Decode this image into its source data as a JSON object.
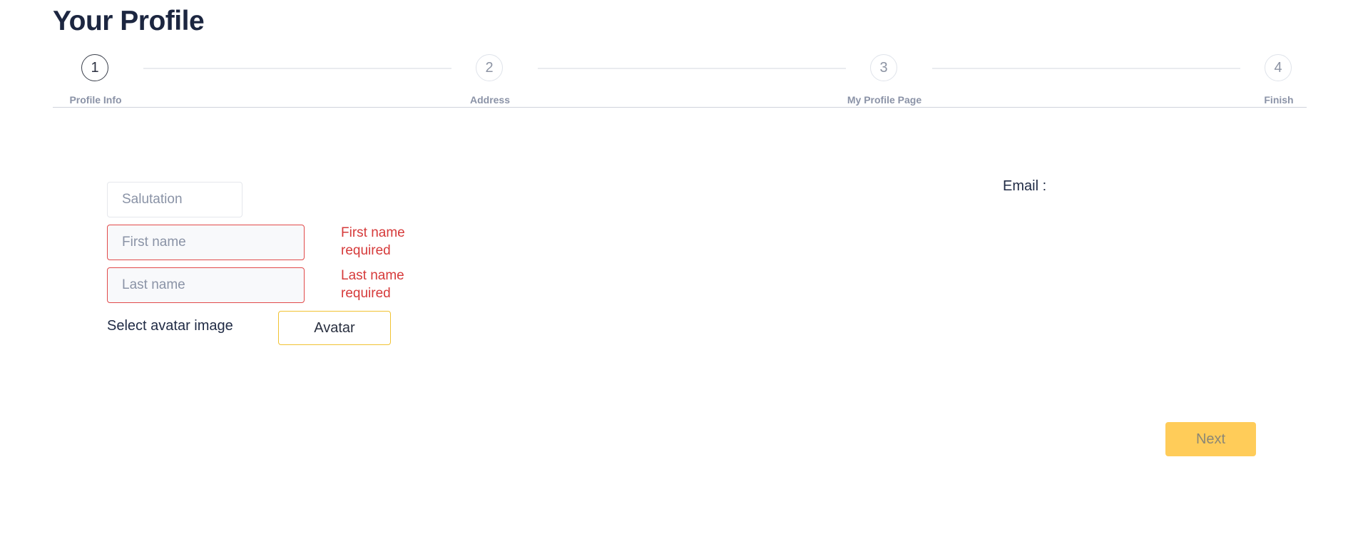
{
  "page": {
    "title": "Your Profile"
  },
  "stepper": {
    "steps": [
      {
        "number": "1",
        "label": "Profile Info",
        "active": true
      },
      {
        "number": "2",
        "label": "Address",
        "active": false
      },
      {
        "number": "3",
        "label": "My Profile Page",
        "active": false
      },
      {
        "number": "4",
        "label": "Finish",
        "active": false
      }
    ]
  },
  "form": {
    "salutation": {
      "placeholder": "Salutation",
      "value": ""
    },
    "first_name": {
      "placeholder": "First name",
      "value": "",
      "error": "First name required"
    },
    "last_name": {
      "placeholder": "Last name",
      "value": "",
      "error": "Last name required"
    },
    "avatar": {
      "label": "Select avatar image",
      "button_label": "Avatar"
    }
  },
  "email": {
    "label": "Email :",
    "value": ""
  },
  "actions": {
    "next_label": "Next"
  },
  "colors": {
    "accent": "#ffcc59",
    "error": "#d63a3a",
    "avatar_border": "#f1c232"
  }
}
